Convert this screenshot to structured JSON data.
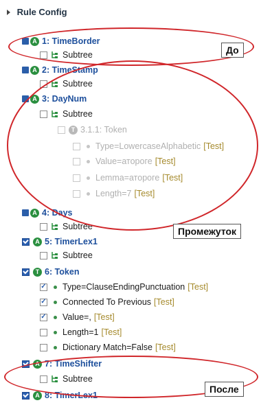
{
  "header": {
    "title": "Rule Config"
  },
  "rows": {
    "r1": {
      "label": "1: TimeBorder"
    },
    "r1s": {
      "label": "Subtree"
    },
    "r2": {
      "label": "2: TimeStamp"
    },
    "r2s": {
      "label": "Subtree"
    },
    "r3": {
      "label": "3: DayNum"
    },
    "r3s": {
      "label": "Subtree"
    },
    "r3t": {
      "label": "3.1.1: Token"
    },
    "r3t1": {
      "label": "Type=LowercaseAlphabetic",
      "test": "[Test]"
    },
    "r3t2": {
      "label": "Value=атороге",
      "test": "[Test]"
    },
    "r3t3": {
      "label": "Lemma=атороге",
      "test": "[Test]"
    },
    "r3t4": {
      "label": "Length=7",
      "test": "[Test]"
    },
    "r4": {
      "label": "4: Days"
    },
    "r4s": {
      "label": "Subtree"
    },
    "r5": {
      "label": "5: TimerLex1"
    },
    "r5s": {
      "label": "Subtree"
    },
    "r6": {
      "label": "6: Token"
    },
    "r6a": {
      "label": "Type=ClauseEndingPunctuation",
      "test": "[Test]"
    },
    "r6b": {
      "label": "Connected To Previous",
      "test": "[Test]"
    },
    "r6c": {
      "label": "Value=,",
      "test": "[Test]"
    },
    "r6d": {
      "label": "Length=1",
      "test": "[Test]"
    },
    "r6e": {
      "label": "Dictionary Match=False",
      "test": "[Test]"
    },
    "r7": {
      "label": "7: TimeShifter"
    },
    "r7s": {
      "label": "Subtree"
    },
    "r8": {
      "label": "8: TimerLex1"
    }
  },
  "callouts": {
    "before": "До",
    "middle": "Промежуток",
    "after": "После"
  },
  "colors": {
    "oval": "#d0262a",
    "link": "#1d4f9c",
    "test": "#a58a2c"
  },
  "icons": {
    "rule": "rule-icon",
    "subtree": "subtree-icon",
    "status": "status-icon"
  }
}
